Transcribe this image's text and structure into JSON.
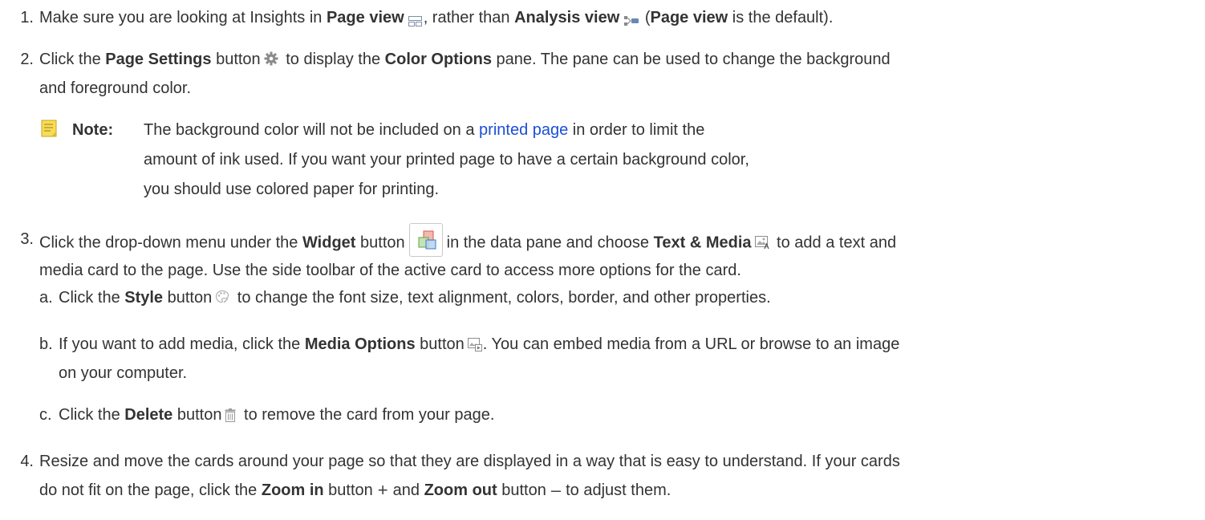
{
  "steps": [
    {
      "num": "1.",
      "parts": {
        "t1": "Make sure you are looking at Insights in ",
        "b1": "Page view",
        "t2": ", rather than ",
        "b2": "Analysis view",
        "t3": " (",
        "b3": "Page view",
        "t4": " is the default)."
      }
    },
    {
      "num": "2.",
      "parts": {
        "t1": "Click the ",
        "b1": "Page Settings",
        "t2": " button",
        "t3": " to display the ",
        "b2": "Color Options",
        "t4": " pane. The pane can be used to change the background",
        "t5": "and foreground color."
      }
    },
    {
      "num": "3.",
      "parts": {
        "t1": "Click the drop-down menu under the ",
        "b1": "Widget",
        "t2": " button",
        "t3": "in the data pane and choose ",
        "b2": "Text & Media",
        "t4": " to add a text and",
        "t5": "media card to the page. Use the side toolbar of the active card to access more options for the card."
      },
      "substeps": [
        {
          "letter": "a.",
          "t1": "Click the ",
          "b1": "Style",
          "t2": " button",
          "t3": " to change the font size, text alignment, colors, border, and other properties."
        },
        {
          "letter": "b.",
          "t1": "If you want to add media, click the ",
          "b1": "Media Options",
          "t2": " button",
          "t3": ". You can embed media from a URL or browse to an image",
          "t4": "on your computer."
        },
        {
          "letter": "c.",
          "t1": "Click the ",
          "b1": "Delete",
          "t2": " button",
          "t3": " to remove the card from your page."
        }
      ]
    },
    {
      "num": "4.",
      "parts": {
        "t1": "Resize and move the cards around your page so that they are displayed in a way that is easy to understand. If your cards",
        "t2": "do not fit on the page, click the ",
        "b1": "Zoom in",
        "t3": " button",
        "z1": "+",
        "t4": "and ",
        "b2": "Zoom out",
        "t5": " button",
        "z2": "–",
        "t6": "to adjust them."
      }
    }
  ],
  "note": {
    "label": "Note:",
    "t1": "The background color will not be included on a ",
    "link": "printed page",
    "t2": " in order to limit the",
    "l2": "amount of ink used. If you want your printed page to have a certain background color,",
    "l3": "you should use colored paper for printing."
  },
  "icons": {
    "page_view": "page-view-icon",
    "analysis_view": "analysis-view-icon",
    "page_settings": "gear-icon",
    "widget": "widget-icon",
    "text_media": "text-media-icon",
    "style": "style-palette-icon",
    "media_options": "media-options-icon",
    "delete": "trash-icon",
    "note": "note-icon",
    "zoom_in": "plus-icon",
    "zoom_out": "minus-icon"
  },
  "colors": {
    "text": "#333333",
    "link": "#1a4fd6",
    "note_icon": "#e8c43a"
  }
}
